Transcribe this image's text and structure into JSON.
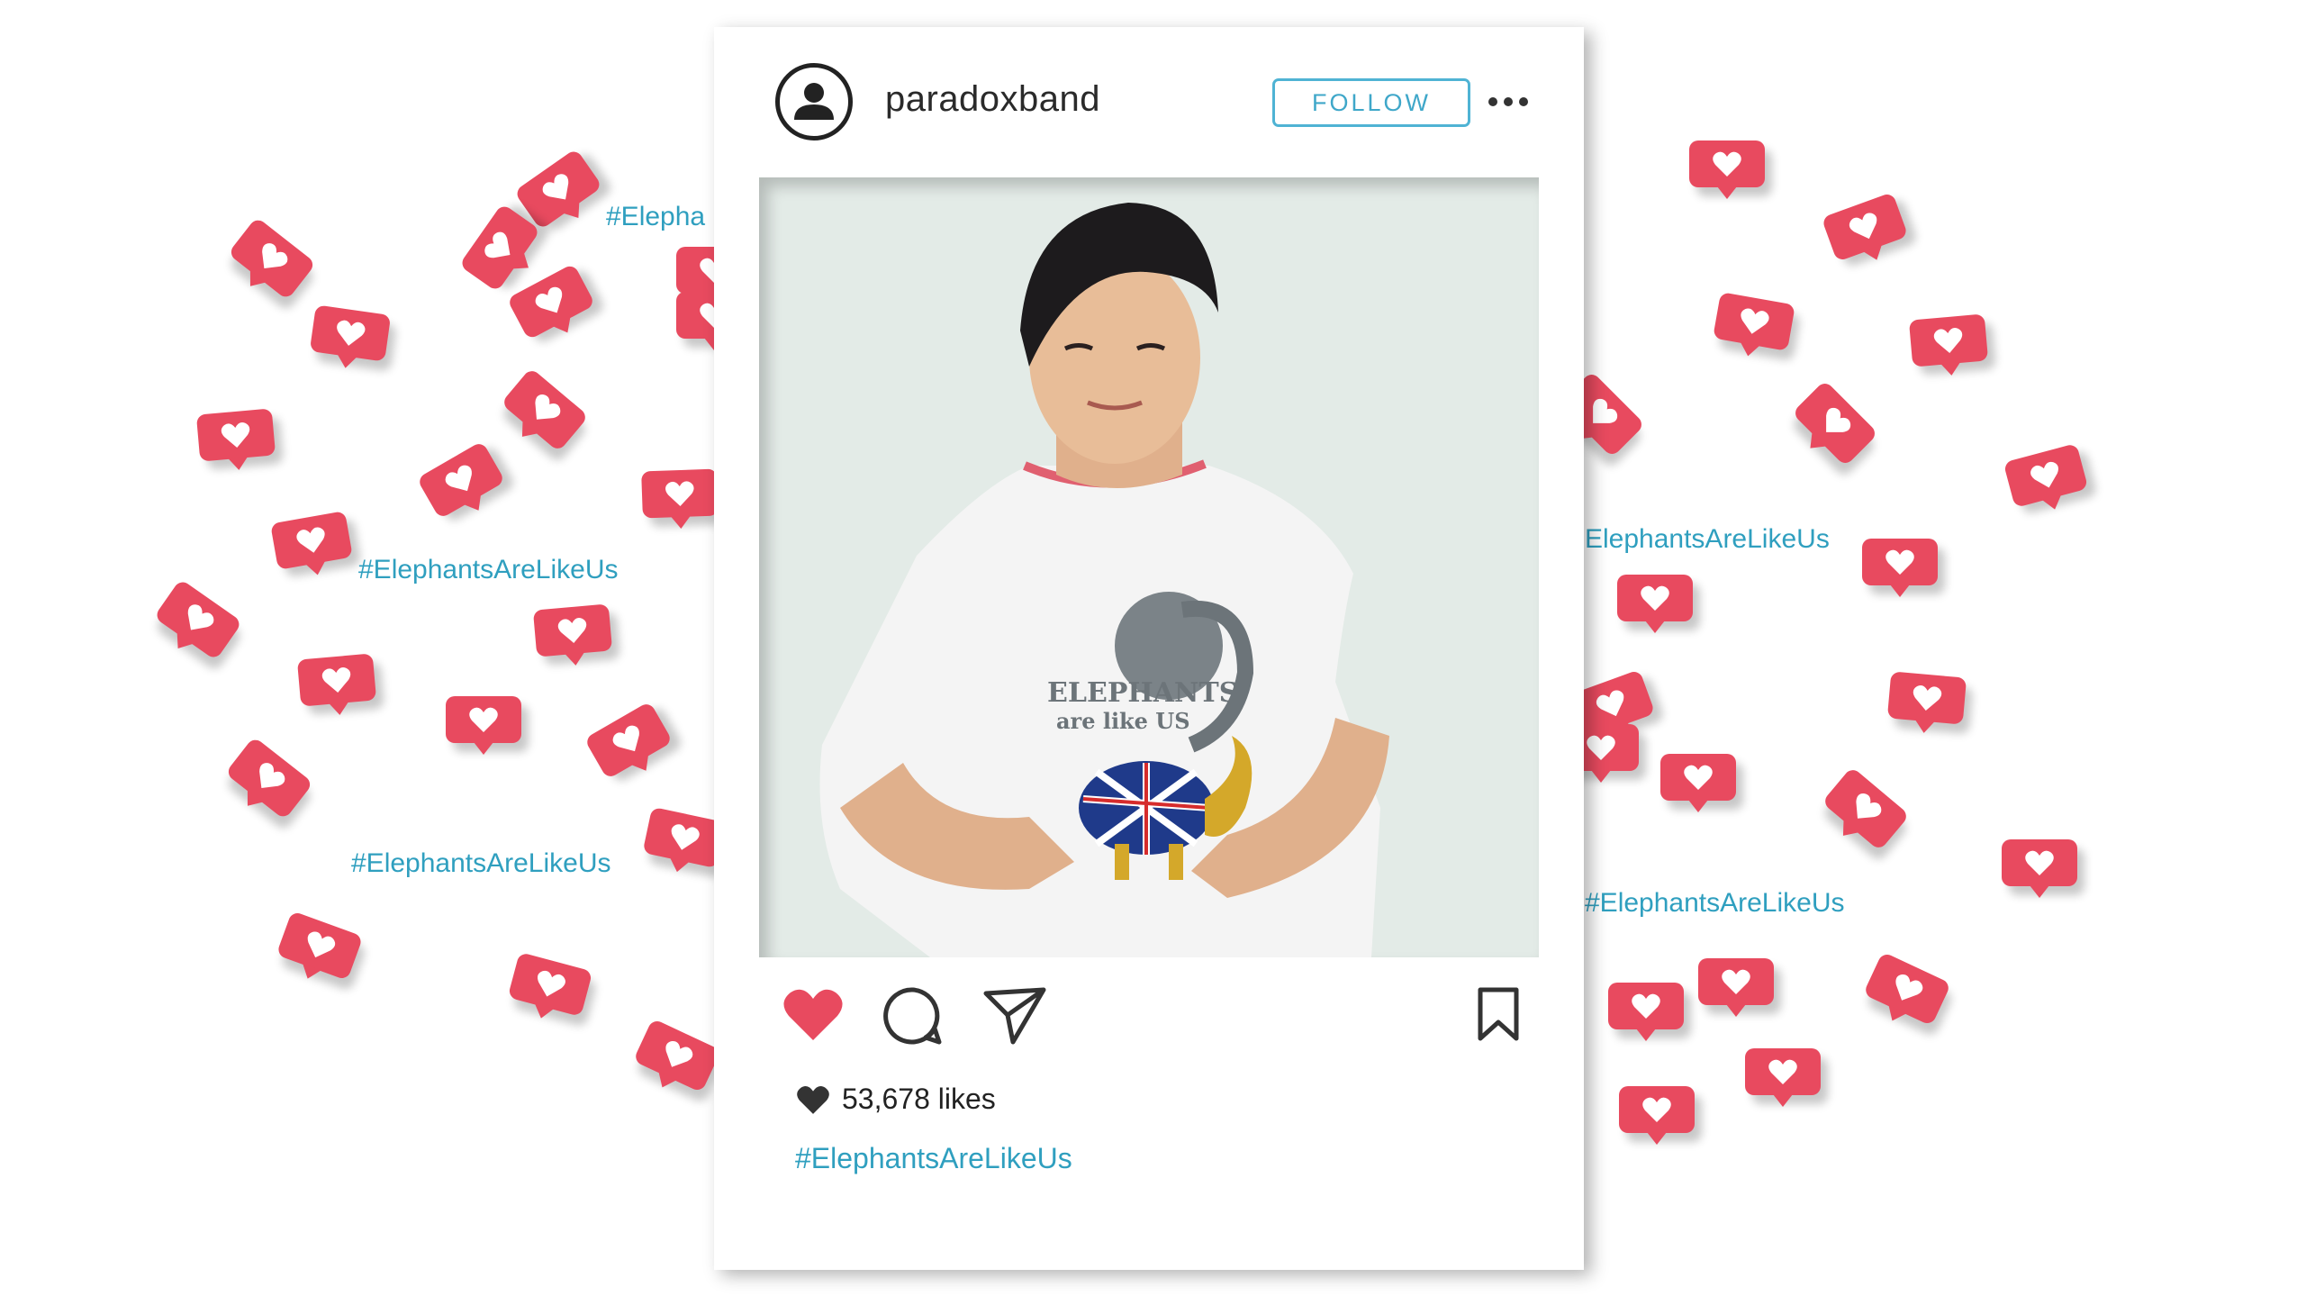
{
  "post": {
    "username": "paradoxband",
    "follow_label": "FOLLOW",
    "likes_count": "53,678 likes",
    "caption": "#ElephantsAreLikeUs",
    "photo_shirt_text_line1": "ELEPHANTS",
    "photo_shirt_text_line2": "are like US"
  },
  "background": {
    "hashtag_left_top": "#Elepha",
    "hashtag_left_mid": "#ElephantsAreLikeUs",
    "hashtag_left_bottom": "#ElephantsAreLikeUs",
    "hashtag_right_mid": "ElephantsAreLikeUs",
    "hashtag_right_bottom": "#ElephantsAreLikeUs"
  },
  "icons": {
    "avatar": "user-icon",
    "more": "more-options-icon",
    "like": "heart-filled-icon",
    "comment": "comment-icon",
    "share": "send-icon",
    "save": "bookmark-icon",
    "badge": "like-notification-icon"
  },
  "colors": {
    "accent": "#4fb3d4",
    "hashtag": "#2f9fbf",
    "like_red": "#e84a5f",
    "photo_bg": "#e3ebe7"
  }
}
